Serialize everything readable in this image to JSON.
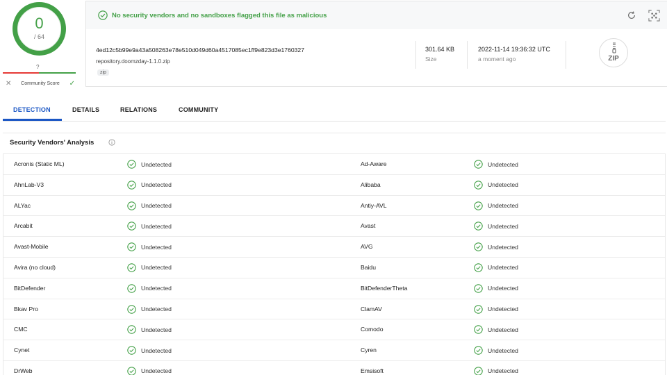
{
  "score": {
    "detections": "0",
    "total": "/ 64",
    "community_unknown": "?",
    "community_label": "Community Score"
  },
  "banner": {
    "message": "No security vendors and no sandboxes flagged this file as malicious"
  },
  "file": {
    "hash": "4ed12c5b99e9a43a508263e78e510d049d60a4517085ec1ff9e823d3e1760327",
    "name": "repository.doomzday-1.1.0.zip",
    "tag": "zip",
    "size_value": "301.64 KB",
    "size_label": "Size",
    "date_value": "2022-11-14 19:36:32 UTC",
    "date_label": "a moment ago",
    "type_icon_label": "ZIP"
  },
  "tabs": [
    "DETECTION",
    "DETAILS",
    "RELATIONS",
    "COMMUNITY"
  ],
  "section": {
    "title": "Security Vendors' Analysis"
  },
  "vendors": [
    {
      "left_name": "Acronis (Static ML)",
      "left_status": "Undetected",
      "right_name": "Ad-Aware",
      "right_status": "Undetected"
    },
    {
      "left_name": "AhnLab-V3",
      "left_status": "Undetected",
      "right_name": "Alibaba",
      "right_status": "Undetected"
    },
    {
      "left_name": "ALYac",
      "left_status": "Undetected",
      "right_name": "Antiy-AVL",
      "right_status": "Undetected"
    },
    {
      "left_name": "Arcabit",
      "left_status": "Undetected",
      "right_name": "Avast",
      "right_status": "Undetected"
    },
    {
      "left_name": "Avast-Mobile",
      "left_status": "Undetected",
      "right_name": "AVG",
      "right_status": "Undetected"
    },
    {
      "left_name": "Avira (no cloud)",
      "left_status": "Undetected",
      "right_name": "Baidu",
      "right_status": "Undetected"
    },
    {
      "left_name": "BitDefender",
      "left_status": "Undetected",
      "right_name": "BitDefenderTheta",
      "right_status": "Undetected"
    },
    {
      "left_name": "Bkav Pro",
      "left_status": "Undetected",
      "right_name": "ClamAV",
      "right_status": "Undetected"
    },
    {
      "left_name": "CMC",
      "left_status": "Undetected",
      "right_name": "Comodo",
      "right_status": "Undetected"
    },
    {
      "left_name": "Cynet",
      "left_status": "Undetected",
      "right_name": "Cyren",
      "right_status": "Undetected"
    },
    {
      "left_name": "DrWeb",
      "left_status": "Undetected",
      "right_name": "Emsisoft",
      "right_status": "Undetected"
    }
  ],
  "colors": {
    "clean_green": "#43a047",
    "alert_red": "#e53935",
    "accent_blue": "#1a56c4"
  }
}
